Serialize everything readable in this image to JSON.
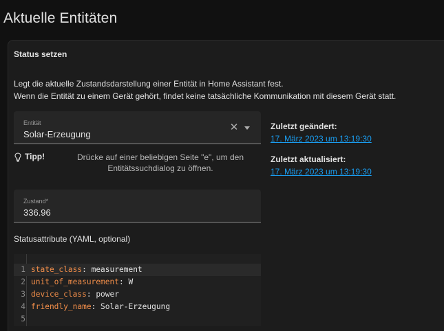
{
  "page": {
    "title": "Aktuelle Entitäten"
  },
  "card": {
    "title": "Status setzen",
    "description_line1": "Legt die aktuelle Zustandsdarstellung einer Entität in Home Assistant fest.",
    "description_line2": "Wenn die Entität zu einem Gerät gehört, findet keine tatsächliche Kommunikation mit diesem Gerät statt."
  },
  "entity_field": {
    "label": "Entität",
    "value": "Solar-Erzeugung",
    "clear_icon": "close-icon",
    "dropdown_icon": "chevron-down-icon"
  },
  "tip": {
    "label": "Tipp!",
    "text": "Drücke auf einer beliebigen Seite \"e\", um den Entitätssuchdialog zu öffnen.",
    "icon": "lightbulb-icon"
  },
  "state_field": {
    "label": "Zustand*",
    "value": "336.96"
  },
  "attributes": {
    "label": "Statusattribute (YAML, optional)",
    "lines": [
      {
        "num": "1",
        "key": "state_class",
        "value": "measurement"
      },
      {
        "num": "2",
        "key": "unit_of_measurement",
        "value": "W"
      },
      {
        "num": "3",
        "key": "device_class",
        "value": "power"
      },
      {
        "num": "4",
        "key": "friendly_name",
        "value": "Solar-Erzeugung"
      },
      {
        "num": "5",
        "key": "",
        "value": ""
      }
    ]
  },
  "last_changed": {
    "label": "Zuletzt geändert:",
    "value": "17. März 2023 um 13:19:30"
  },
  "last_updated": {
    "label": "Zuletzt aktualisiert:",
    "value": "17. März 2023 um 13:19:30"
  },
  "colors": {
    "accent_link": "#1a9df0",
    "yaml_key": "#f08d49",
    "background": "#111111",
    "card": "#1c1c1c"
  }
}
